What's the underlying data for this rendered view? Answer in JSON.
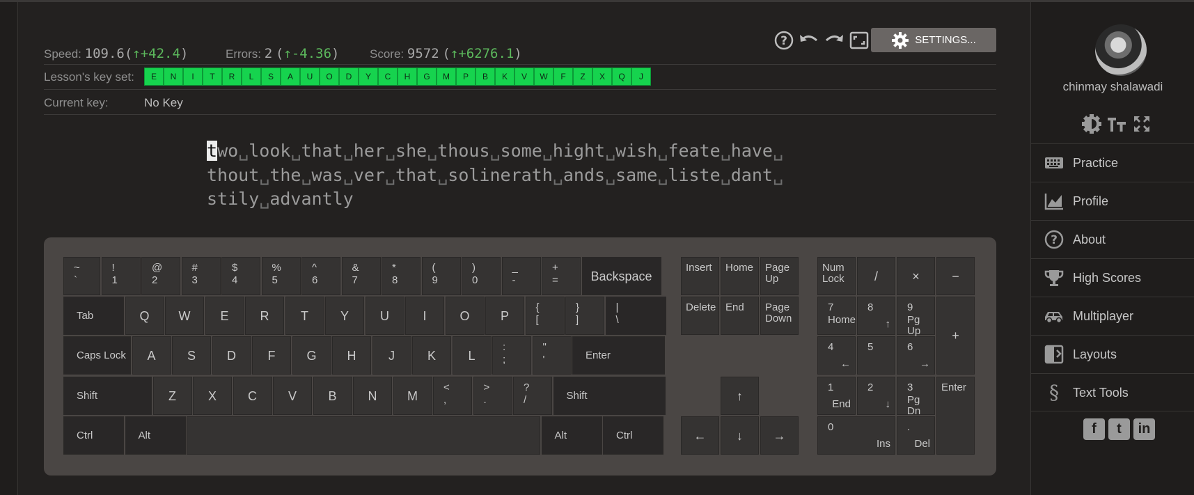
{
  "stats": {
    "speed_label": "Speed:",
    "speed_value": "109.6",
    "speed_delta": "+42.4",
    "errors_label": "Errors:",
    "errors_value": "2",
    "errors_delta": "-4.36",
    "score_label": "Score:",
    "score_value": "9572",
    "score_delta": "+6276.1"
  },
  "toolbar": {
    "settings_label": "SETTINGS...",
    "icons": [
      "help-icon",
      "undo-icon",
      "redo-icon",
      "fullscreen-icon",
      "gear-icon"
    ]
  },
  "lesson": {
    "keyset_label": "Lesson's key set:",
    "keys": [
      "E",
      "N",
      "I",
      "T",
      "R",
      "L",
      "S",
      "A",
      "U",
      "O",
      "D",
      "Y",
      "C",
      "H",
      "G",
      "M",
      "P",
      "B",
      "K",
      "V",
      "W",
      "F",
      "Z",
      "X",
      "Q",
      "J"
    ],
    "keyset_color": "#16d34e",
    "current_key_label": "Current key:",
    "current_key_value": "No Key"
  },
  "text": {
    "cursor_char": "t",
    "lines": [
      [
        "wo",
        "look",
        "that",
        "her",
        "she",
        "thous",
        "some",
        "hight",
        "wish",
        "feate",
        "have",
        ""
      ],
      [
        "thout",
        "the",
        "was",
        "ver",
        "that",
        "solinerath",
        "ands",
        "same",
        "liste",
        "dant",
        ""
      ],
      [
        "stily",
        "advantly"
      ]
    ],
    "space_glyph": "␣"
  },
  "keyboard": {
    "rows": [
      [
        {
          "t": "~",
          "b": "`"
        },
        {
          "t": "!",
          "b": "1"
        },
        {
          "t": "@",
          "b": "2"
        },
        {
          "t": "#",
          "b": "3"
        },
        {
          "t": "$",
          "b": "4"
        },
        {
          "t": "%",
          "b": "5"
        },
        {
          "t": "^",
          "b": "6"
        },
        {
          "t": "&",
          "b": "7"
        },
        {
          "t": "*",
          "b": "8"
        },
        {
          "t": "(",
          "b": "9"
        },
        {
          "t": ")",
          "b": "0"
        },
        {
          "t": "_",
          "b": "-"
        },
        {
          "t": "+",
          "b": "="
        },
        {
          "c": "Backspace"
        }
      ],
      [
        {
          "m": "Tab"
        },
        {
          "c": "Q"
        },
        {
          "c": "W"
        },
        {
          "c": "E"
        },
        {
          "c": "R"
        },
        {
          "c": "T"
        },
        {
          "c": "Y"
        },
        {
          "c": "U"
        },
        {
          "c": "I"
        },
        {
          "c": "O"
        },
        {
          "c": "P"
        },
        {
          "t": "{",
          "b": "["
        },
        {
          "t": "}",
          "b": "]"
        },
        {
          "t": "|",
          "b": "\\"
        }
      ],
      [
        {
          "m": "Caps Lock"
        },
        {
          "c": "A"
        },
        {
          "c": "S"
        },
        {
          "c": "D"
        },
        {
          "c": "F"
        },
        {
          "c": "G"
        },
        {
          "c": "H"
        },
        {
          "c": "J"
        },
        {
          "c": "K"
        },
        {
          "c": "L"
        },
        {
          "t": ":",
          "b": ";"
        },
        {
          "t": "\"",
          "b": "'"
        },
        {
          "m": "Enter"
        }
      ],
      [
        {
          "m": "Shift"
        },
        {
          "c": "Z"
        },
        {
          "c": "X"
        },
        {
          "c": "C"
        },
        {
          "c": "V"
        },
        {
          "c": "B"
        },
        {
          "c": "N"
        },
        {
          "c": "M"
        },
        {
          "t": "<",
          "b": ","
        },
        {
          "t": ">",
          "b": "."
        },
        {
          "t": "?",
          "b": "/"
        },
        {
          "m": "Shift"
        }
      ],
      [
        {
          "m": "Ctrl"
        },
        {
          "m": "Alt"
        },
        {
          "c": ""
        },
        {
          "m": "Alt"
        },
        {
          "m": "Ctrl"
        }
      ]
    ],
    "nav": [
      {
        "tl": "Insert"
      },
      {
        "tl": "Home"
      },
      {
        "tl": "Page\nUp"
      },
      {
        "tl": "Delete"
      },
      {
        "tl": "End"
      },
      {
        "tl": "Page\nDown"
      },
      {
        "c": "↑"
      },
      {
        "c": "←"
      },
      {
        "c": "↓"
      },
      {
        "c": "→"
      }
    ],
    "numpad": [
      {
        "tl": "Num\nLock"
      },
      {
        "c": "/"
      },
      {
        "c": "×"
      },
      {
        "c": "−"
      },
      {
        "t": "7",
        "b": "Home"
      },
      {
        "t": "8",
        "br": "↑"
      },
      {
        "t": "9",
        "b": "Pg Up"
      },
      {
        "c": "+"
      },
      {
        "t": "4",
        "br": "←"
      },
      {
        "t": "5"
      },
      {
        "t": "6",
        "br": "→"
      },
      {
        "t": "1",
        "br": "End"
      },
      {
        "t": "2",
        "br": "↓"
      },
      {
        "t": "3",
        "b": "Pg Dn"
      },
      {
        "tl": "Enter"
      },
      {
        "t": "0",
        "br": "Ins"
      },
      {
        "t": ".",
        "br": "Del"
      }
    ]
  },
  "sidebar": {
    "username": "chinmay shalawadi",
    "nav": [
      {
        "label": "Practice",
        "icon": "keyboard-icon"
      },
      {
        "label": "Profile",
        "icon": "chart-icon"
      },
      {
        "label": "About",
        "icon": "question-icon"
      },
      {
        "label": "High Scores",
        "icon": "trophy-icon"
      },
      {
        "label": "Multiplayer",
        "icon": "car-icon"
      },
      {
        "label": "Layouts",
        "icon": "layouts-icon"
      },
      {
        "label": "Text Tools",
        "icon": "section-icon"
      }
    ],
    "social": [
      "f",
      "t",
      "in"
    ]
  }
}
